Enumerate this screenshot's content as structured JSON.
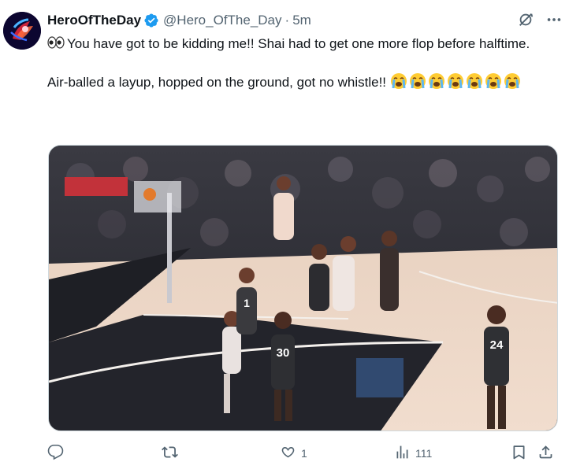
{
  "tweet": {
    "display_name": "HeroOfTheDay",
    "handle": "@Hero_OfThe_Day",
    "separator": "·",
    "time": "5m",
    "line1": "You have got to be kidding me!! Shai had to get one more flop before halftime.",
    "line2": "Air-balled a layup, hopped on the ground, got no whistle!!",
    "crying_emoji_count": 7
  },
  "media": {
    "jersey_numbers": [
      "1",
      "30",
      "24"
    ]
  },
  "actions": {
    "reply_count": "",
    "retweet_count": "",
    "like_count": "1",
    "view_count": "111"
  },
  "icons": {
    "verified": "verified-badge-icon",
    "grok": "grok-icon",
    "more": "more-icon",
    "reply": "reply-icon",
    "retweet": "retweet-icon",
    "like": "heart-icon",
    "views": "views-icon",
    "bookmark": "bookmark-icon",
    "share": "share-icon"
  },
  "colors": {
    "accent": "#1d9bf0",
    "text": "#0f1419",
    "muted": "#536471"
  }
}
